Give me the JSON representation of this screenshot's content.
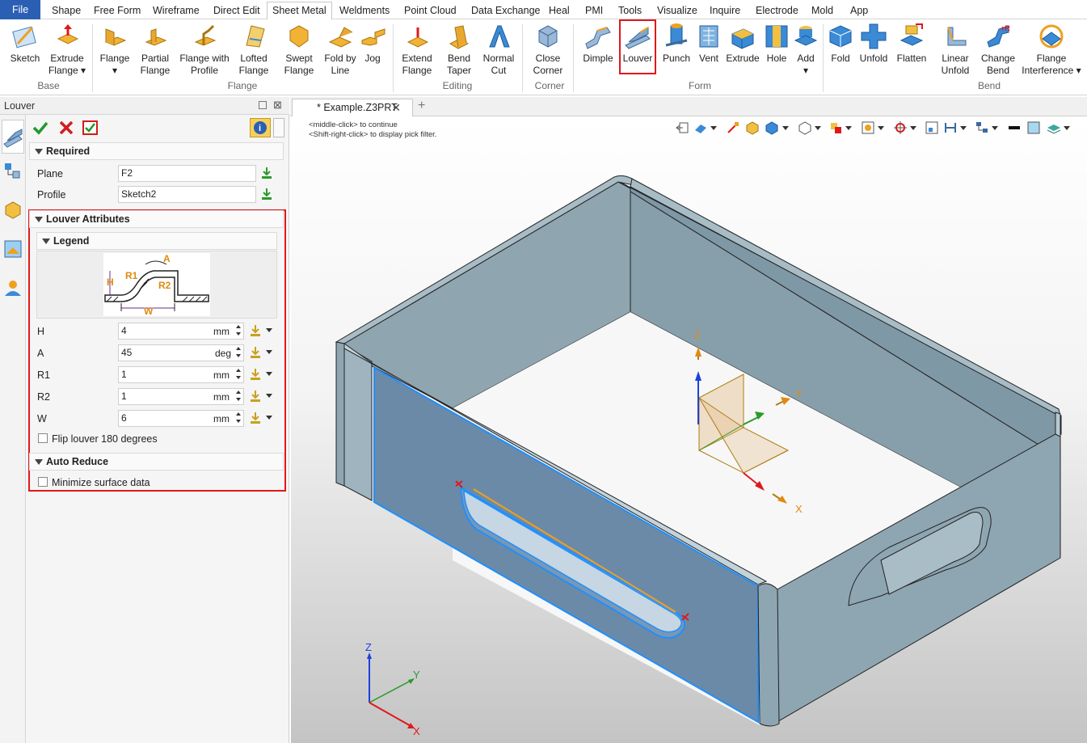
{
  "menu": {
    "tabs": [
      "File",
      "Shape",
      "Free Form",
      "Wireframe",
      "Direct Edit",
      "Sheet Metal",
      "Weldments",
      "Point Cloud",
      "Data Exchange",
      "Heal",
      "PMI",
      "Tools",
      "Visualize",
      "Inquire",
      "Electrode",
      "Mold",
      "App"
    ],
    "active_tab": "Sheet Metal"
  },
  "ribbon": {
    "buttons": [
      {
        "l1": "Sketch",
        "l2": ""
      },
      {
        "l1": "Extrude",
        "l2": "Flange ▾"
      },
      {
        "l1": "Flange",
        "l2": "▾"
      },
      {
        "l1": "Partial",
        "l2": "Flange"
      },
      {
        "l1": "Flange with",
        "l2": "Profile"
      },
      {
        "l1": "Lofted",
        "l2": "Flange"
      },
      {
        "l1": "Swept",
        "l2": "Flange"
      },
      {
        "l1": "Fold by",
        "l2": "Line"
      },
      {
        "l1": "Jog",
        "l2": ""
      },
      {
        "l1": "Extend",
        "l2": "Flange"
      },
      {
        "l1": "Bend",
        "l2": "Taper"
      },
      {
        "l1": "Normal",
        "l2": "Cut"
      },
      {
        "l1": "Close",
        "l2": "Corner"
      },
      {
        "l1": "Dimple",
        "l2": ""
      },
      {
        "l1": "Louver",
        "l2": ""
      },
      {
        "l1": "Punch",
        "l2": ""
      },
      {
        "l1": "Vent",
        "l2": ""
      },
      {
        "l1": "Extrude",
        "l2": ""
      },
      {
        "l1": "Hole",
        "l2": ""
      },
      {
        "l1": "Add",
        "l2": "▾"
      },
      {
        "l1": "Fold",
        "l2": ""
      },
      {
        "l1": "Unfold",
        "l2": ""
      },
      {
        "l1": "Flatten",
        "l2": ""
      },
      {
        "l1": "Linear",
        "l2": "Unfold"
      },
      {
        "l1": "Change",
        "l2": "Bend"
      },
      {
        "l1": "Flange",
        "l2": "Interference ▾"
      }
    ],
    "groups": [
      "Base",
      "Flange",
      "Editing",
      "Corner",
      "Form",
      "Bend"
    ]
  },
  "panel": {
    "title": "Louver",
    "required": {
      "header": "Required",
      "plane_label": "Plane",
      "plane_value": "F2",
      "profile_label": "Profile",
      "profile_value": "Sketch2"
    },
    "attributes": {
      "header": "Louver Attributes",
      "legend_header": "Legend",
      "legend_letters": {
        "A": "A",
        "H": "H",
        "R1": "R1",
        "R2": "R2",
        "W": "W"
      },
      "fields": [
        {
          "label": "H",
          "value": "4",
          "unit": "mm"
        },
        {
          "label": "A",
          "value": "45",
          "unit": "deg"
        },
        {
          "label": "R1",
          "value": "1",
          "unit": "mm"
        },
        {
          "label": "R2",
          "value": "1",
          "unit": "mm"
        },
        {
          "label": "W",
          "value": "6",
          "unit": "mm"
        }
      ],
      "flip_label": "Flip louver 180 degrees"
    },
    "auto_reduce": {
      "header": "Auto Reduce",
      "minimize_label": "Minimize surface data"
    }
  },
  "document": {
    "tab_title": "* Example.Z3PRT",
    "hint1": "<middle-click> to continue",
    "hint2": "<Shift-right-click> to display pick filter."
  },
  "axes": {
    "x": "X",
    "y": "Y",
    "z": "Z"
  },
  "colors": {
    "accent_blue": "#2b5fb4",
    "highlight_red": "#e0181b",
    "part_gray": "#8fa4ae",
    "selected_face": "#6b8aa8"
  }
}
